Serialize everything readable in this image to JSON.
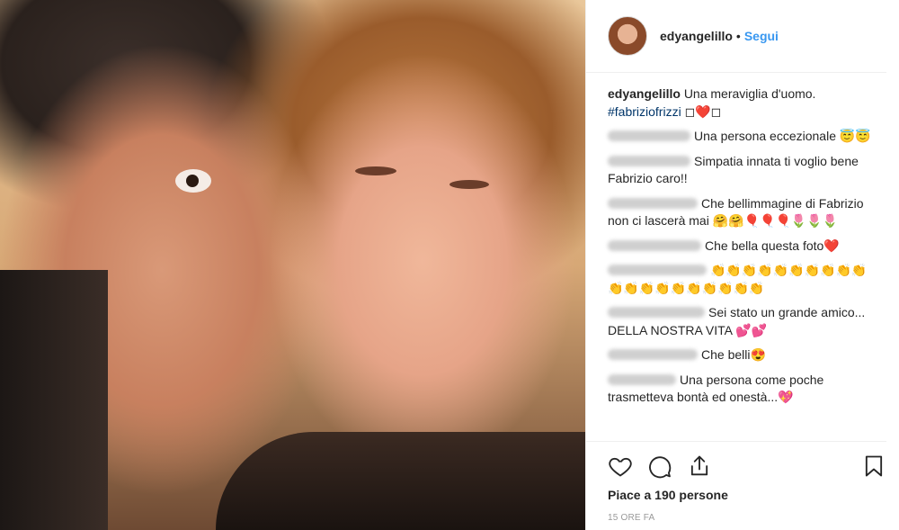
{
  "post": {
    "username": "edyangelillo",
    "follow_label": "Segui",
    "separator": "•"
  },
  "comments": [
    {
      "user": "edyangelillo",
      "text": "Una meraviglia d'uomo. ",
      "hashtag": "#fabriziofrizzi",
      "suffix": " ◻❤️◻"
    },
    {
      "user": "",
      "text": "Una persona eccezionale 😇😇"
    },
    {
      "user": "",
      "text": "Simpatia innata ti voglio bene Fabrizio caro!!"
    },
    {
      "user": "",
      "text": "Che bellimmagine di Fabrizio non ci lascerà mai 🤗🤗🎈🎈🎈🌷🌷🌷"
    },
    {
      "user": "",
      "text": "Che bella questa foto❤️"
    },
    {
      "user": "",
      "text": "👏👏👏👏👏👏👏👏👏👏👏👏👏👏👏👏👏👏👏👏"
    },
    {
      "user": "",
      "text": "Sei stato un grande amico... DELLA NOSTRA VITA 💕💕"
    },
    {
      "user": "",
      "text": "Che belli😍"
    },
    {
      "user": "",
      "text": "Una persona come poche trasmetteva bontà ed onestà...💖"
    }
  ],
  "likes": "Piace a 190 persone",
  "time": "15 ORE FA",
  "icons": [
    "heart-icon",
    "comment-icon",
    "share-icon",
    "bookmark-icon"
  ]
}
